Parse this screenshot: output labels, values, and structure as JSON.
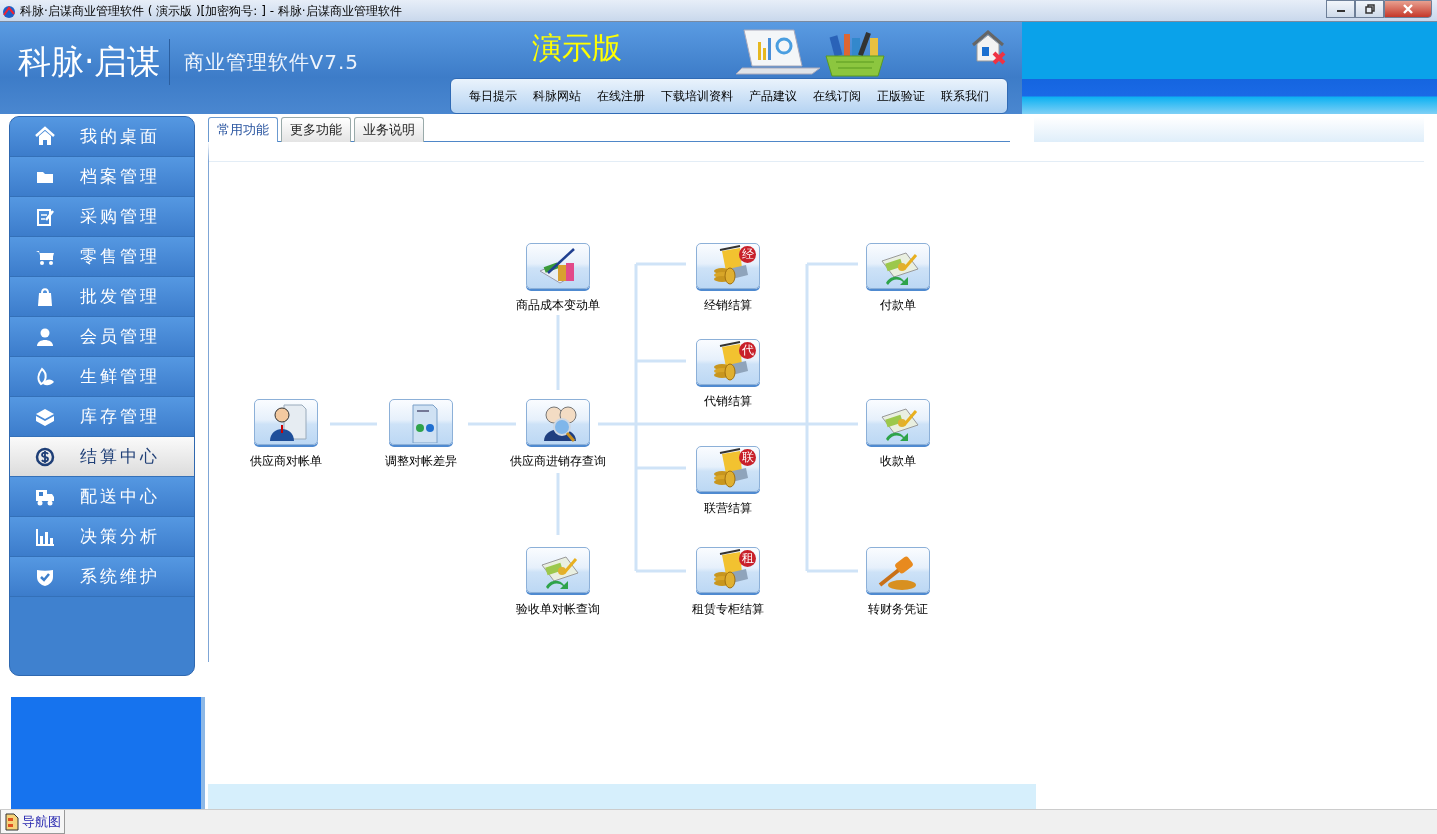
{
  "window": {
    "title": "科脉·启谋商业管理软件 ( 演示版 )[加密狗号: ] - 科脉·启谋商业管理软件"
  },
  "header": {
    "brand": "科脉·启谋",
    "product": "商业管理软件V7.5",
    "edition": "演示版",
    "nav": [
      "每日提示",
      "科脉网站",
      "在线注册",
      "下载培训资料",
      "产品建议",
      "在线订阅",
      "正版验证",
      "联系我们"
    ]
  },
  "sidebar": {
    "items": [
      {
        "label": "我的桌面",
        "selected": false
      },
      {
        "label": "档案管理",
        "selected": false
      },
      {
        "label": "采购管理",
        "selected": false
      },
      {
        "label": "零售管理",
        "selected": false
      },
      {
        "label": "批发管理",
        "selected": false
      },
      {
        "label": "会员管理",
        "selected": false
      },
      {
        "label": "生鲜管理",
        "selected": false
      },
      {
        "label": "库存管理",
        "selected": false
      },
      {
        "label": "结算中心",
        "selected": true
      },
      {
        "label": "配送中心",
        "selected": false
      },
      {
        "label": "决策分析",
        "selected": false
      },
      {
        "label": "系统维护",
        "selected": false
      }
    ]
  },
  "tabs": [
    {
      "label": "常用功能",
      "selected": true
    },
    {
      "label": "更多功能",
      "selected": false
    },
    {
      "label": "业务说明",
      "selected": false
    }
  ],
  "diagram": {
    "nodes": [
      {
        "label": "商品成本变动单",
        "kind": "bags"
      },
      {
        "label": "经销结算",
        "kind": "coins",
        "badge": "经"
      },
      {
        "label": "付款单",
        "kind": "bill"
      },
      {
        "label": "代销结算",
        "kind": "coins",
        "badge": "代"
      },
      {
        "label": "供应商对帐单",
        "kind": "person"
      },
      {
        "label": "调整对帐差异",
        "kind": "document"
      },
      {
        "label": "供应商进销存查询",
        "kind": "magnifier"
      },
      {
        "label": "联营结算",
        "kind": "coins",
        "badge": "联"
      },
      {
        "label": "收款单",
        "kind": "bill"
      },
      {
        "label": "验收单对帐查询",
        "kind": "bill"
      },
      {
        "label": "租赁专柜结算",
        "kind": "coins",
        "badge": "租"
      },
      {
        "label": "转财务凭证",
        "kind": "gavel"
      }
    ]
  },
  "status_bar": {
    "tabs": [
      {
        "label": "导航图",
        "selected": true
      }
    ]
  }
}
